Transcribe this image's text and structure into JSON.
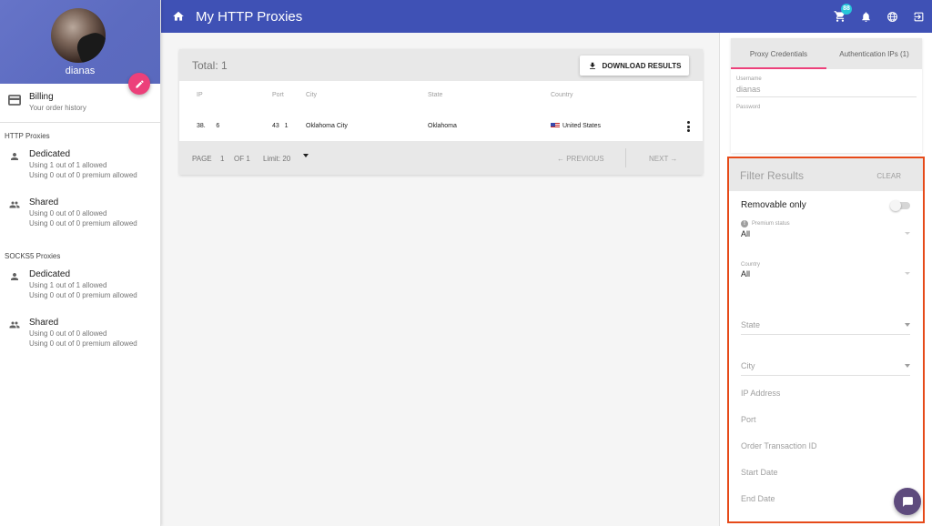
{
  "profile": {
    "username": "dianas"
  },
  "sidebar": {
    "billing": {
      "title": "Billing",
      "subtitle": "Your order history"
    },
    "sections": [
      {
        "title": "HTTP Proxies",
        "items": [
          {
            "icon": "person-icon",
            "title": "Dedicated",
            "line1": "Using 1 out of 1 allowed",
            "line2": "Using 0 out of 0 premium allowed"
          },
          {
            "icon": "people-icon",
            "title": "Shared",
            "line1": "Using 0 out of 0 allowed",
            "line2": "Using 0 out of 0 premium allowed"
          }
        ]
      },
      {
        "title": "SOCKS5 Proxies",
        "items": [
          {
            "icon": "person-icon",
            "title": "Dedicated",
            "line1": "Using 1 out of 1 allowed",
            "line2": "Using 0 out of 0 premium allowed"
          },
          {
            "icon": "people-icon",
            "title": "Shared",
            "line1": "Using 0 out of 0 allowed",
            "line2": "Using 0 out of 0 premium allowed"
          }
        ]
      }
    ]
  },
  "topbar": {
    "title": "My HTTP Proxies",
    "cart_badge": "88",
    "icons": [
      "home-icon",
      "cart-icon",
      "bell-icon",
      "globe-icon",
      "logout-icon"
    ]
  },
  "results": {
    "total_label": "Total: 1",
    "download_label": "DOWNLOAD RESULTS",
    "columns": [
      "IP",
      "Port",
      "City",
      "State",
      "Country"
    ],
    "rows": [
      {
        "ip": "38.      6",
        "port": "43   1",
        "city": "Oklahoma City",
        "state": "Oklahoma",
        "country": "United States"
      }
    ],
    "pagination": {
      "page_label": "PAGE",
      "page": "1",
      "of_label": "OF 1",
      "limit_label": "Limit: 20",
      "prev_label": "← PREVIOUS",
      "next_label": "NEXT →"
    }
  },
  "credentials": {
    "tabs": [
      {
        "label": "Proxy Credentials",
        "active": true
      },
      {
        "label": "Authentication IPs (1)",
        "active": false
      }
    ],
    "username_label": "Username",
    "username_value": "dianas",
    "password_label": "Password",
    "password_value": ""
  },
  "filter": {
    "title": "Filter Results",
    "clear_label": "CLEAR",
    "removable_label": "Removable only",
    "removable_on": false,
    "premium_label": "Premium status",
    "premium_value": "All",
    "country_label": "Country",
    "country_value": "All",
    "state_placeholder": "State",
    "city_placeholder": "City",
    "ip_placeholder": "IP Address",
    "port_placeholder": "Port",
    "order_placeholder": "Order Transaction ID",
    "start_placeholder": "Start Date",
    "end_placeholder": "End Date"
  },
  "colors": {
    "primary": "#3f51b5",
    "accent": "#ec407a",
    "highlight_border": "#e64a19",
    "badge": "#26c6da",
    "chat": "#5e4b7d"
  }
}
